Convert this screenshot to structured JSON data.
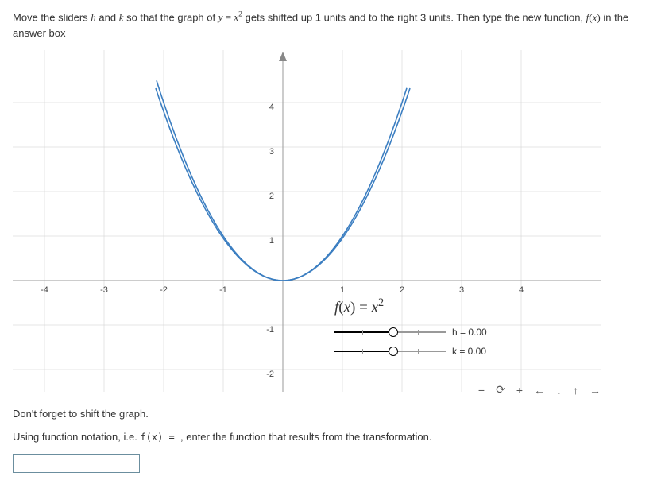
{
  "instructions": {
    "prefix": "Move the sliders ",
    "h": "h",
    "and": " and ",
    "k": "k",
    "middle": " so that the graph of ",
    "eq": "y = x²",
    "after_eq": " gets shifted up 1 units and to the right 3 units. Then type the new function, ",
    "fx": "f(x)",
    "tail": " in the answer box"
  },
  "axes": {
    "x_ticks": [
      "-4",
      "-3",
      "-2",
      "-1",
      "1",
      "2",
      "3",
      "4"
    ],
    "y_ticks_pos": [
      "1",
      "2",
      "3",
      "4"
    ],
    "y_ticks_neg": [
      "-1",
      "-2"
    ]
  },
  "overlay": {
    "formula_lhs": "f(x)",
    "formula_eq": " = ",
    "formula_rhs": "x²",
    "h_label": "h = 0.00",
    "k_label": "k = 0.00"
  },
  "nav": {
    "minus": "−",
    "reset": "⟳",
    "plus": "+",
    "left": "←",
    "down": "↓",
    "up": "↑",
    "right": "→"
  },
  "reminder": "Don't forget to shift the graph.",
  "second_line": {
    "prefix": "Using function notation, i.e. ",
    "fx": "f(x) = ",
    "suffix": ", enter the function that results from the transformation."
  },
  "answer": {
    "value": "",
    "placeholder": ""
  },
  "chart_data": {
    "type": "line",
    "title": "",
    "xlabel": "",
    "ylabel": "",
    "xlim": [
      -4.5,
      4.5
    ],
    "ylim": [
      -2.5,
      4.5
    ],
    "series": [
      {
        "name": "f(x) = x^2",
        "x": [
          -2.1,
          -2,
          -1.5,
          -1,
          -0.5,
          0,
          0.5,
          1,
          1.5,
          2,
          2.1
        ],
        "y": [
          4.41,
          4,
          2.25,
          1,
          0.25,
          0,
          0.25,
          1,
          2.25,
          4,
          4.41
        ]
      }
    ],
    "sliders": {
      "h": 0.0,
      "k": 0.0
    }
  }
}
